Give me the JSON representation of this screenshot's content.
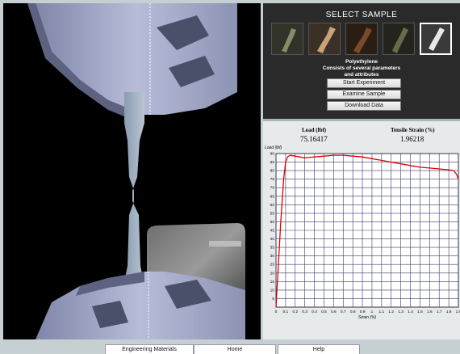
{
  "sample_panel": {
    "title": "SELECT SAMPLE",
    "samples": [
      {
        "name": "sample-1",
        "color": "#8a8a6a"
      },
      {
        "name": "sample-2",
        "color": "#c9a27a"
      },
      {
        "name": "sample-3",
        "color": "#7a4a2a"
      },
      {
        "name": "sample-4",
        "color": "#6a6a4a"
      },
      {
        "name": "sample-5",
        "color": "#e8e8e8"
      }
    ],
    "selected_index": 4,
    "material_name": "Polyethylene",
    "material_desc_line1": "Consists of several parameters",
    "material_desc_line2": "and attributes",
    "buttons": {
      "start": "Start Experiment",
      "examine": "Examine Sample",
      "download": "Download Data"
    }
  },
  "readouts": {
    "load_label": "Load (lbf)",
    "load_value": "75.16417",
    "strain_label": "Tensile Strain (%)",
    "strain_value": "1.96218"
  },
  "chart_data": {
    "type": "line",
    "ylabel": "Load (lbf)",
    "xlabel": "Strain (%)",
    "xlim": [
      0,
      1.9
    ],
    "ylim": [
      0,
      90
    ],
    "x_ticks": [
      "0",
      "0.1",
      "0.2",
      "0.3",
      "0.4",
      "0.5",
      "0.6",
      "0.7",
      "0.8",
      "0.9",
      "1",
      "1.1",
      "1.2",
      "1.3",
      "1.4",
      "1.5",
      "1.6",
      "1.7",
      "1.8",
      "1.9"
    ],
    "y_ticks": [
      "5",
      "10",
      "15",
      "20",
      "25",
      "30",
      "35",
      "40",
      "45",
      "50",
      "55",
      "60",
      "65",
      "70",
      "75",
      "80",
      "85",
      "90"
    ],
    "grid": true,
    "series": [
      {
        "color": "#e00000",
        "x": [
          0,
          0.02,
          0.05,
          0.08,
          0.1,
          0.12,
          0.15,
          0.2,
          0.3,
          0.4,
          0.5,
          0.6,
          0.7,
          0.8,
          0.9,
          1.0,
          1.1,
          1.2,
          1.3,
          1.4,
          1.5,
          1.6,
          1.7,
          1.8,
          1.85,
          1.88,
          1.9
        ],
        "y": [
          0,
          20,
          50,
          75,
          85,
          88,
          89,
          88.5,
          87.5,
          88,
          88.5,
          89,
          89,
          88.5,
          88,
          87,
          86,
          85,
          84,
          83,
          82,
          81.5,
          81,
          80.5,
          80,
          78,
          75
        ]
      }
    ]
  },
  "footer": {
    "engineering": "Engineering Materials",
    "home": "Home",
    "help": "Help"
  }
}
